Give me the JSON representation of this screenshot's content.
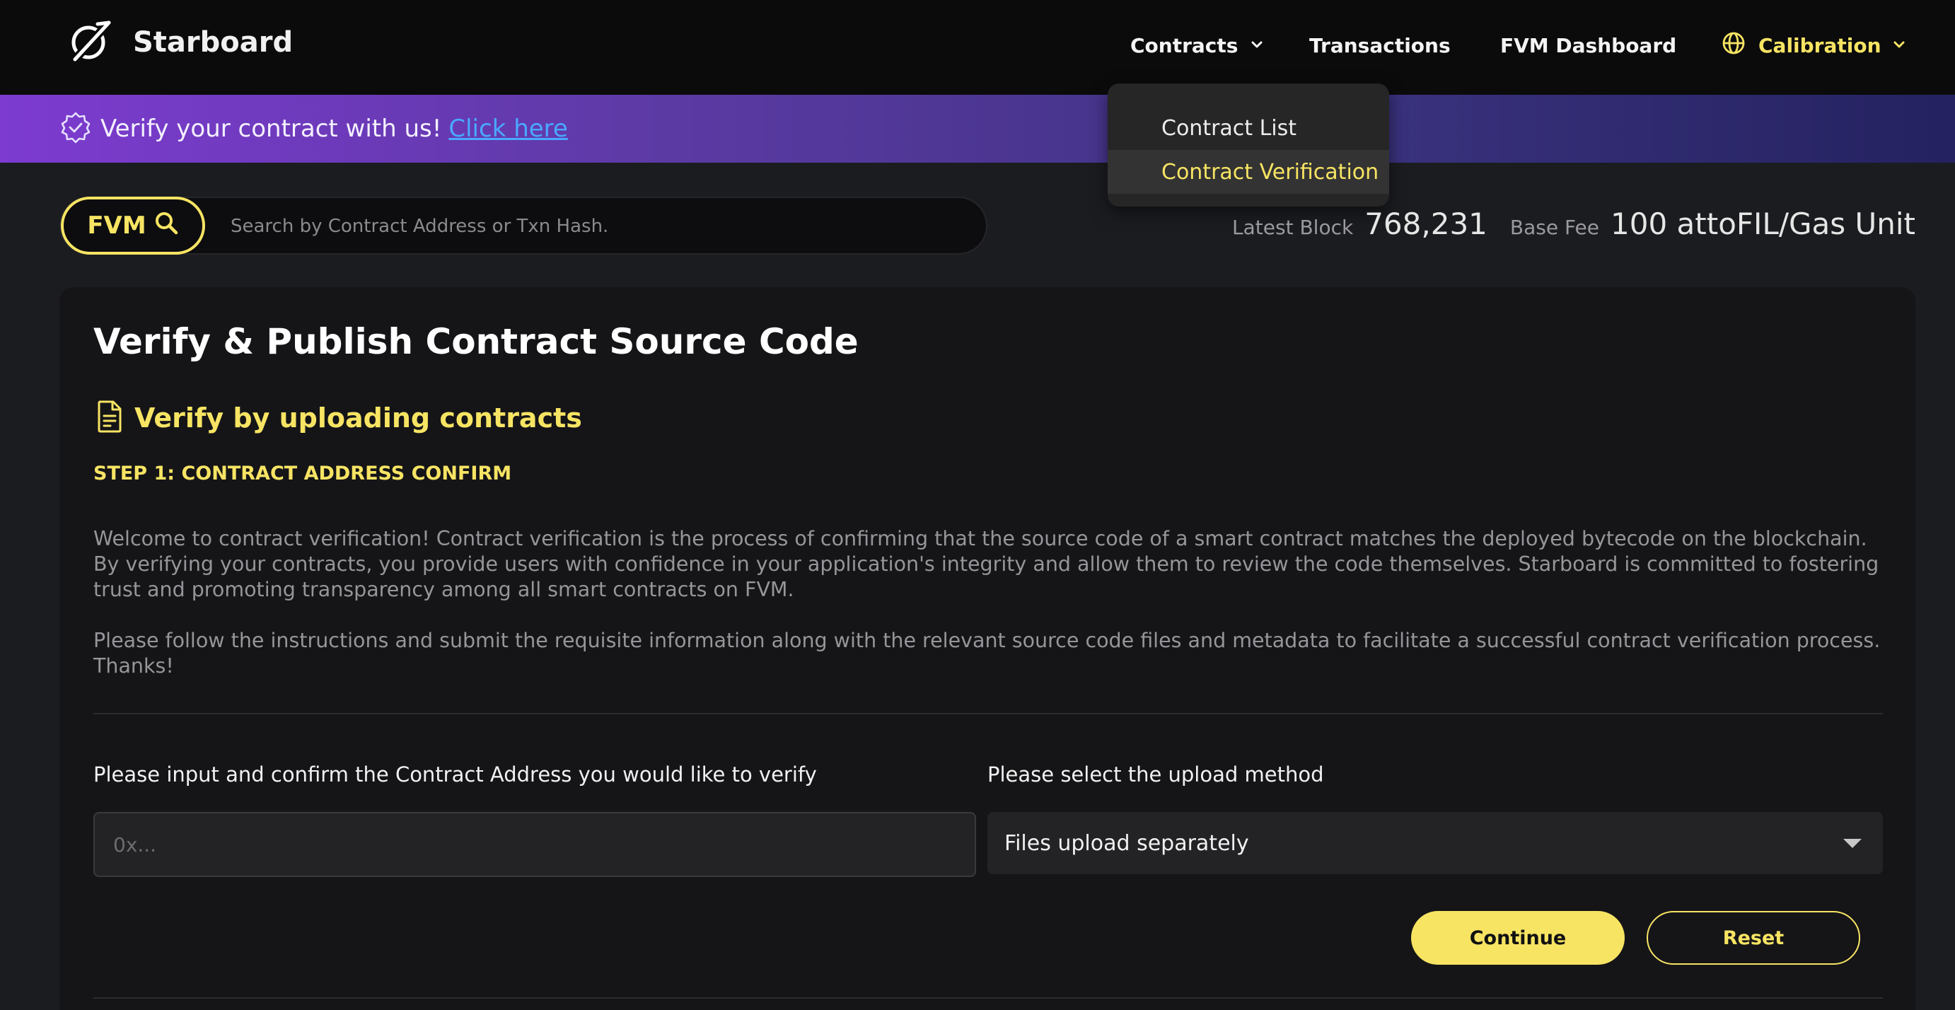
{
  "header": {
    "brand_name": "Starboard",
    "nav": {
      "contracts": "Contracts",
      "transactions": "Transactions",
      "fvm_dashboard": "FVM Dashboard",
      "network": "Calibration"
    }
  },
  "contracts_menu": {
    "items": [
      {
        "label": "Contract List",
        "active": false
      },
      {
        "label": "Contract Verification",
        "active": true
      }
    ]
  },
  "banner": {
    "text": "Verify your contract with us!",
    "link": "Click here"
  },
  "search": {
    "pill_label": "FVM",
    "placeholder": "Search by Contract Address or Txn Hash."
  },
  "stats": {
    "latest_block_label": "Latest Block",
    "latest_block_value": "768,231",
    "base_fee_label": "Base Fee",
    "base_fee_value": "100 attoFIL/Gas Unit"
  },
  "main": {
    "title": "Verify & Publish Contract Source Code",
    "section_title": "Verify by uploading contracts",
    "step": "STEP 1: CONTRACT ADDRESS CONFIRM",
    "paragraph1": "Welcome to contract verification! Contract verification is the process of confirming that the source code of a smart contract matches the deployed bytecode on the blockchain. By verifying your contracts, you provide users with confidence in your application's integrity and allow them to review the code themselves. Starboard is committed to fostering trust and promoting transparency among all smart contracts on FVM.",
    "paragraph2": "Please follow the instructions and submit the requisite information along with the relevant source code files and metadata to facilitate a successful contract verification process. Thanks!",
    "address_label": "Please input and confirm the Contract Address you would like to verify",
    "address_placeholder": "0x...",
    "method_label": "Please select the upload method",
    "method_value": "Files upload separately",
    "continue_label": "Continue",
    "reset_label": "Reset"
  },
  "colors": {
    "accent": "#f7e463",
    "background": "#1b1c20",
    "card": "#151518",
    "banner_start": "#7d3bd0",
    "banner_end": "#242260",
    "link": "#4aa8ff"
  },
  "icons": {
    "logo": "starboard-logo-icon",
    "contracts_chevron": "chevron-down-icon",
    "network": "globe-icon",
    "banner": "verified-badge-icon",
    "search": "search-icon",
    "section": "document-icon",
    "select": "caret-down-icon"
  }
}
